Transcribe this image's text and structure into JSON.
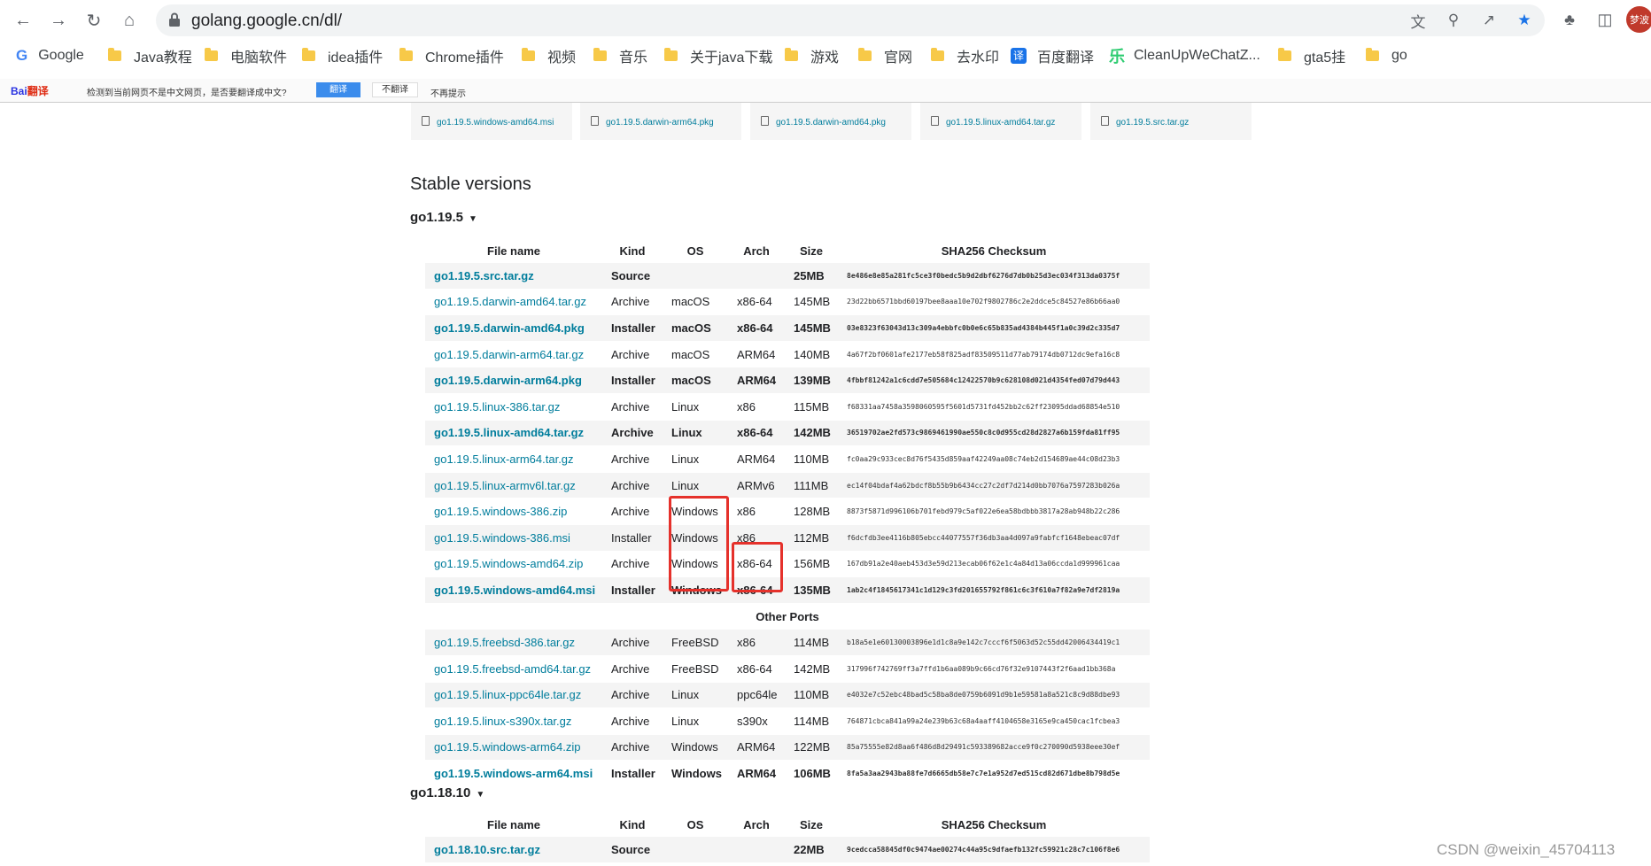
{
  "browser": {
    "url": "golang.google.cn/dl/",
    "profile_label": "梦波"
  },
  "bookmarks": [
    {
      "label": "Google",
      "icon": "google-icon"
    },
    {
      "label": "Java教程",
      "icon": "folder-icon"
    },
    {
      "label": "电脑软件",
      "icon": "folder-icon"
    },
    {
      "label": "idea插件",
      "icon": "folder-icon"
    },
    {
      "label": "Chrome插件",
      "icon": "folder-icon"
    },
    {
      "label": "视频",
      "icon": "folder-icon"
    },
    {
      "label": "音乐",
      "icon": "folder-icon"
    },
    {
      "label": "关于java下载",
      "icon": "folder-icon"
    },
    {
      "label": "游戏",
      "icon": "folder-icon"
    },
    {
      "label": "官网",
      "icon": "folder-icon"
    },
    {
      "label": "去水印",
      "icon": "folder-icon"
    },
    {
      "label": "百度翻译",
      "icon": "translate-icon"
    },
    {
      "label": "CleanUpWeChatZ...",
      "icon": "cleanup-icon"
    },
    {
      "label": "gta5挂",
      "icon": "folder-icon"
    },
    {
      "label": "go",
      "icon": "folder-icon"
    }
  ],
  "baidu_bar": {
    "logo": "Bai",
    "logo_suffix": "翻译",
    "message": "检测到当前网页不是中文网页，是否要翻译成中文?",
    "translate": "翻译",
    "no_translate": "不翻译",
    "no_prompt": "不再提示"
  },
  "featured": [
    "go1.19.5.windows-amd64.msi",
    "go1.19.5.darwin-arm64.pkg",
    "go1.19.5.darwin-amd64.pkg",
    "go1.19.5.linux-amd64.tar.gz",
    "go1.19.5.src.tar.gz"
  ],
  "stable_heading": "Stable versions",
  "headers": {
    "file_name": "File name",
    "kind": "Kind",
    "os": "OS",
    "arch": "Arch",
    "size": "Size",
    "checksum": "SHA256 Checksum"
  },
  "other_ports": "Other Ports",
  "v1195": {
    "title": "go1.19.5",
    "rows": [
      {
        "file": "go1.19.5.src.tar.gz",
        "kind": "Source",
        "os": "",
        "arch": "",
        "size": "25MB",
        "sum": "8e486e8e85a281fc5ce3f0bedc5b9d2dbf6276d7db0b25d3ec034f313da0375f",
        "bold": true
      },
      {
        "file": "go1.19.5.darwin-amd64.tar.gz",
        "kind": "Archive",
        "os": "macOS",
        "arch": "x86-64",
        "size": "145MB",
        "sum": "23d22bb6571bbd60197bee8aaa10e702f9802786c2e2ddce5c84527e86b66aa0",
        "bold": false
      },
      {
        "file": "go1.19.5.darwin-amd64.pkg",
        "kind": "Installer",
        "os": "macOS",
        "arch": "x86-64",
        "size": "145MB",
        "sum": "03e8323f63043d13c309a4ebbfc0b0e6c65b835ad4384b445f1a0c39d2c335d7",
        "bold": true
      },
      {
        "file": "go1.19.5.darwin-arm64.tar.gz",
        "kind": "Archive",
        "os": "macOS",
        "arch": "ARM64",
        "size": "140MB",
        "sum": "4a67f2bf0601afe2177eb58f825adf83509511d77ab79174db0712dc9efa16c8",
        "bold": false
      },
      {
        "file": "go1.19.5.darwin-arm64.pkg",
        "kind": "Installer",
        "os": "macOS",
        "arch": "ARM64",
        "size": "139MB",
        "sum": "4fbbf81242a1c6cdd7e505684c12422570b9c628108d021d4354fed07d79d443",
        "bold": true
      },
      {
        "file": "go1.19.5.linux-386.tar.gz",
        "kind": "Archive",
        "os": "Linux",
        "arch": "x86",
        "size": "115MB",
        "sum": "f68331aa7458a3598060595f5601d5731fd452bb2c62ff23095ddad68854e510",
        "bold": false
      },
      {
        "file": "go1.19.5.linux-amd64.tar.gz",
        "kind": "Archive",
        "os": "Linux",
        "arch": "x86-64",
        "size": "142MB",
        "sum": "36519702ae2fd573c9869461990ae550c8c0d955cd28d2827a6b159fda81ff95",
        "bold": true
      },
      {
        "file": "go1.19.5.linux-arm64.tar.gz",
        "kind": "Archive",
        "os": "Linux",
        "arch": "ARM64",
        "size": "110MB",
        "sum": "fc0aa29c933cec8d76f5435d859aaf42249aa08c74eb2d154689ae44c08d23b3",
        "bold": false
      },
      {
        "file": "go1.19.5.linux-armv6l.tar.gz",
        "kind": "Archive",
        "os": "Linux",
        "arch": "ARMv6",
        "size": "111MB",
        "sum": "ec14f04bdaf4a62bdcf8b55b9b6434cc27c2df7d214d0bb7076a7597283b026a",
        "bold": false
      },
      {
        "file": "go1.19.5.windows-386.zip",
        "kind": "Archive",
        "os": "Windows",
        "arch": "x86",
        "size": "128MB",
        "sum": "8873f5871d996106b701febd979c5af022e6ea58bdbbb3817a28ab948b22c286",
        "bold": false
      },
      {
        "file": "go1.19.5.windows-386.msi",
        "kind": "Installer",
        "os": "Windows",
        "arch": "x86",
        "size": "112MB",
        "sum": "f6dcfdb3ee4116b805ebcc44077557f36db3aa4d097a9fabfcf1648ebeac07df",
        "bold": false
      },
      {
        "file": "go1.19.5.windows-amd64.zip",
        "kind": "Archive",
        "os": "Windows",
        "arch": "x86-64",
        "size": "156MB",
        "sum": "167db91a2e40aeb453d3e59d213ecab06f62e1c4a84d13a06ccda1d999961caa",
        "bold": false
      },
      {
        "file": "go1.19.5.windows-amd64.msi",
        "kind": "Installer",
        "os": "Windows",
        "arch": "x86-64",
        "size": "135MB",
        "sum": "1ab2c4f1845617341c1d129c3fd201655792f861c6c3f610a7f82a9e7df2819a",
        "bold": true
      }
    ],
    "other_rows": [
      {
        "file": "go1.19.5.freebsd-386.tar.gz",
        "kind": "Archive",
        "os": "FreeBSD",
        "arch": "x86",
        "size": "114MB",
        "sum": "b18a5e1e60130003896e1d1c8a9e142c7cccf6f5063d52c55dd42006434419c1",
        "bold": false
      },
      {
        "file": "go1.19.5.freebsd-amd64.tar.gz",
        "kind": "Archive",
        "os": "FreeBSD",
        "arch": "x86-64",
        "size": "142MB",
        "sum": "317996f742769ff3a7ffd1b6aa089b9c66cd76f32e9107443f2f6aad1bb368a",
        "bold": false
      },
      {
        "file": "go1.19.5.linux-ppc64le.tar.gz",
        "kind": "Archive",
        "os": "Linux",
        "arch": "ppc64le",
        "size": "110MB",
        "sum": "e4032e7c52ebc48bad5c58ba8de0759b6091d9b1e59581a8a521c8c9d88dbe93",
        "bold": false
      },
      {
        "file": "go1.19.5.linux-s390x.tar.gz",
        "kind": "Archive",
        "os": "Linux",
        "arch": "s390x",
        "size": "114MB",
        "sum": "764871cbca841a99a24e239b63c68a4aaff4104658e3165e9ca450cac1fcbea3",
        "bold": false
      },
      {
        "file": "go1.19.5.windows-arm64.zip",
        "kind": "Archive",
        "os": "Windows",
        "arch": "ARM64",
        "size": "122MB",
        "sum": "85a75555e82d8aa6f486d8d29491c593389682acce9f0c270090d5938eee30ef",
        "bold": false
      },
      {
        "file": "go1.19.5.windows-arm64.msi",
        "kind": "Installer",
        "os": "Windows",
        "arch": "ARM64",
        "size": "106MB",
        "sum": "8fa5a3aa2943ba88fe7d6665db58e7c7e1a952d7ed515cd82d671dbe8b798d5e",
        "bold": true
      }
    ]
  },
  "v11810": {
    "title": "go1.18.10",
    "rows": [
      {
        "file": "go1.18.10.src.tar.gz",
        "kind": "Source",
        "os": "",
        "arch": "",
        "size": "22MB",
        "sum": "9cedcca58845df0c9474ae00274c44a95c9dfaefb132fc59921c28c7c106f8e6",
        "bold": true
      }
    ]
  },
  "watermark": "CSDN @weixin_45704113",
  "colors": {
    "link": "#007d9c",
    "highlight": "#e5312b",
    "row_stripe": "#f4f4f4"
  }
}
